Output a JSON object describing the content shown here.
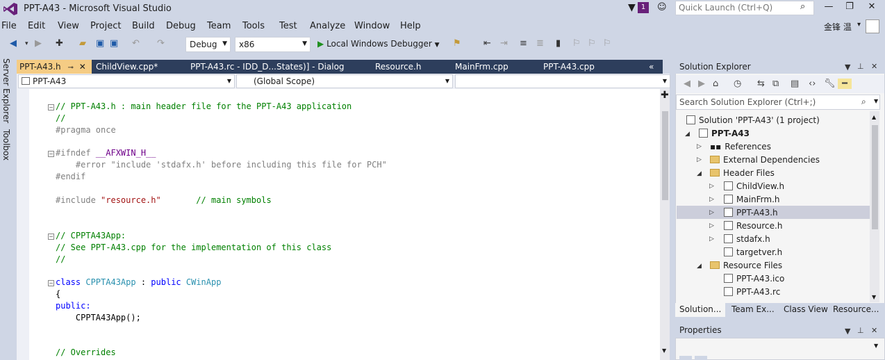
{
  "window": {
    "title": "PPT-A43 - Microsoft Visual Studio",
    "notification_count": "1",
    "quick_launch_placeholder": "Quick Launch (Ctrl+Q)",
    "minimize": "—",
    "maximize": "❐",
    "close": "✕"
  },
  "menu": [
    "File",
    "Edit",
    "View",
    "Project",
    "Build",
    "Debug",
    "Team",
    "Tools",
    "Test",
    "Analyze",
    "Window",
    "Help"
  ],
  "account": {
    "name": "金锋 温",
    "chevron": "▾"
  },
  "toolbar": {
    "config": "Debug",
    "platform": "x86",
    "debugger": "Local Windows Debugger"
  },
  "left_tabs": [
    "Server Explorer",
    "Toolbox"
  ],
  "doc_tabs": [
    "PPT-A43.h",
    "ChildView.cpp*",
    "PPT-A43.rc - IDD_D...States)] - Dialog",
    "Resource.h",
    "MainFrm.cpp",
    "PPT-A43.cpp"
  ],
  "navbar": {
    "project": "PPT-A43",
    "scope": "(Global Scope)",
    "member": ""
  },
  "code": [
    {
      "text": "// PPT-A43.h : main header file for the PPT-A43 application"
    },
    {
      "text": "//"
    },
    {
      "text": "#pragma once"
    },
    {
      "text": "#ifndef "
    },
    {
      "text": "__AFXWIN_H__"
    },
    {
      "text": "    #error \"include 'stdafx.h' before including this file for PCH\""
    },
    {
      "text": "#endif"
    },
    {
      "text": "#include "
    },
    {
      "text": "\"resource.h\""
    },
    {
      "text": "       // main symbols"
    },
    {
      "text": "// CPPTA43App:"
    },
    {
      "text": "// See PPT-A43.cpp for the implementation of this class"
    },
    {
      "text": "//"
    },
    {
      "text": "class "
    },
    {
      "text": "CPPTA43App"
    },
    {
      "text": " : "
    },
    {
      "text": "public "
    },
    {
      "text": "CWinApp"
    },
    {
      "text": "{"
    },
    {
      "text": "public:"
    },
    {
      "text": "    CPPTA43App();"
    },
    {
      "text": "// Overrides"
    }
  ],
  "solution_explorer": {
    "title": "Solution Explorer",
    "search_placeholder": "Search Solution Explorer (Ctrl+;)",
    "tree": [
      {
        "label": "Solution 'PPT-A43' (1 project)"
      },
      {
        "label": "PPT-A43"
      },
      {
        "label": "References"
      },
      {
        "label": "External Dependencies"
      },
      {
        "label": "Header Files"
      },
      {
        "label": "ChildView.h"
      },
      {
        "label": "MainFrm.h"
      },
      {
        "label": "PPT-A43.h"
      },
      {
        "label": "Resource.h"
      },
      {
        "label": "stdafx.h"
      },
      {
        "label": "targetver.h"
      },
      {
        "label": "Resource Files"
      },
      {
        "label": "PPT-A43.ico"
      },
      {
        "label": "PPT-A43.rc"
      }
    ],
    "bottom_tabs": [
      "Solution...",
      "Team Ex...",
      "Class View",
      "Resource..."
    ]
  },
  "properties": {
    "title": "Properties"
  }
}
